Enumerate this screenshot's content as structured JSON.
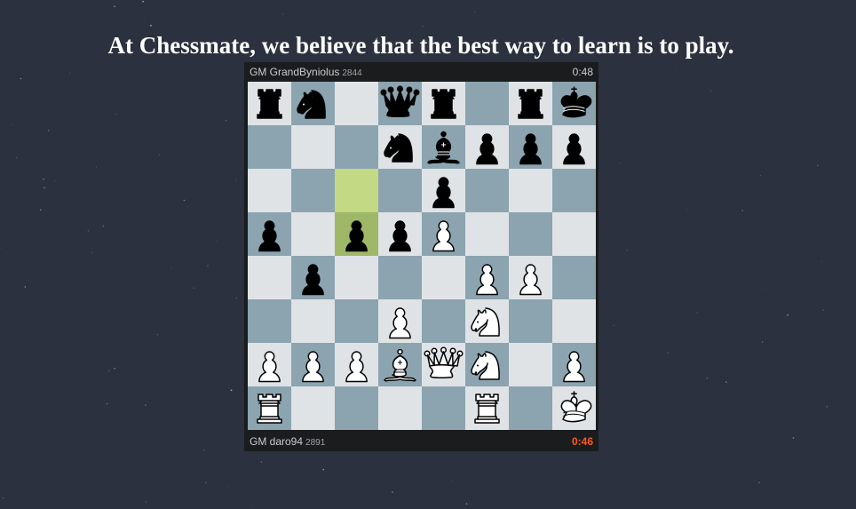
{
  "headline": "At Chessmate, we believe that the best way to learn is to play.",
  "top_player": {
    "name": "GM GrandByniolus",
    "rating": "2844",
    "clock": "0:48"
  },
  "bottom_player": {
    "name": "GM daro94",
    "rating": "2891",
    "clock": "0:46"
  },
  "colors": {
    "background": "#2b313e",
    "light_square": "#dfe3e6",
    "dark_square": "#8ba4b0",
    "highlight_light": "#c4d983",
    "highlight_dark": "#9fb867",
    "active_clock": "#ff5a1f"
  },
  "board": {
    "ranks": [
      "rn.qr.rk.",
      "...nbppp",
      "....p...",
      "p.ppP...",
      ".p...PP.",
      "...P.N..",
      "PPPBQN.P",
      "R....R.K"
    ],
    "highlighted_squares": [
      "c6",
      "c5"
    ],
    "last_move": "c6-c5"
  }
}
